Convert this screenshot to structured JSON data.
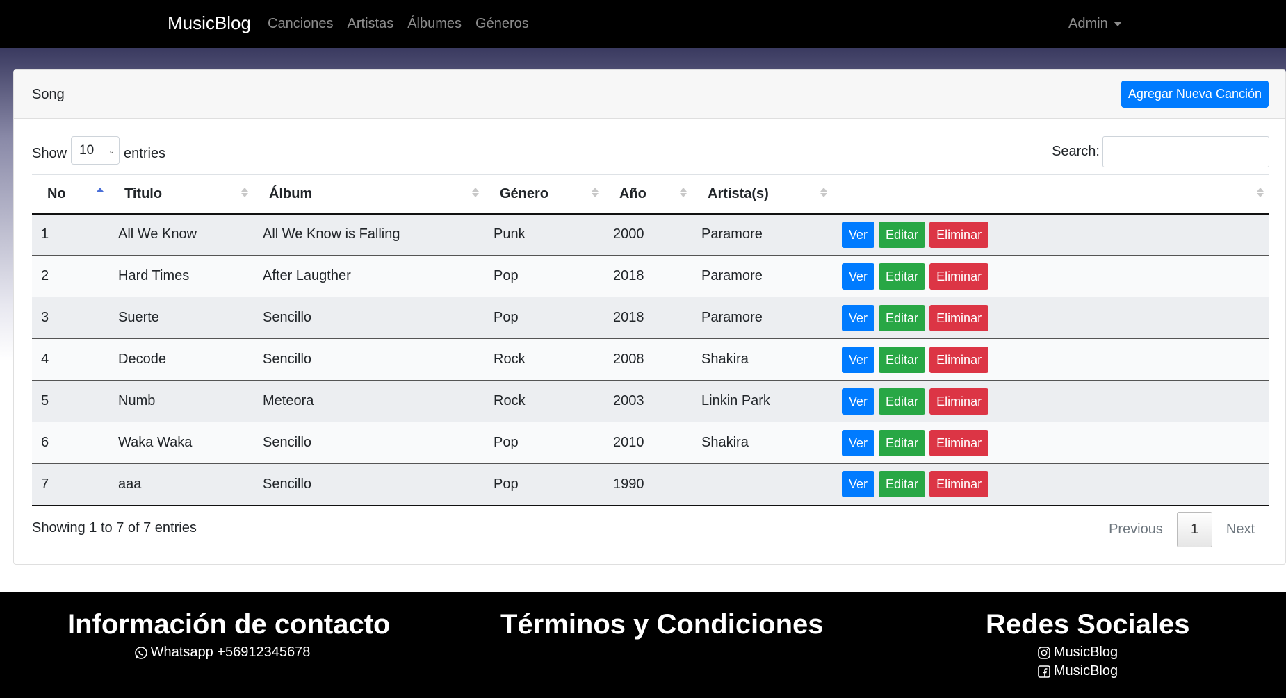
{
  "navbar": {
    "brand": "MusicBlog",
    "links": [
      "Canciones",
      "Artistas",
      "Álbumes",
      "Géneros"
    ],
    "user": "Admin"
  },
  "card": {
    "title": "Song",
    "add_button": "Agregar Nueva Canción"
  },
  "controls": {
    "show_label": "Show",
    "entries_value": "10",
    "entries_label": "entries",
    "search_label": "Search:",
    "search_value": ""
  },
  "table": {
    "headers": [
      "No",
      "Titulo",
      "Álbum",
      "Género",
      "Año",
      "Artista(s)",
      ""
    ],
    "rows": [
      [
        "1",
        "All We Know",
        "All We Know is Falling",
        "Punk",
        "2000",
        "Paramore"
      ],
      [
        "2",
        "Hard Times",
        "After Laugther",
        "Pop",
        "2018",
        "Paramore"
      ],
      [
        "3",
        "Suerte",
        "Sencillo",
        "Pop",
        "2018",
        "Paramore"
      ],
      [
        "4",
        "Decode",
        "Sencillo",
        "Rock",
        "2008",
        "Shakira"
      ],
      [
        "5",
        "Numb",
        "Meteora",
        "Rock",
        "2003",
        "Linkin Park"
      ],
      [
        "6",
        "Waka Waka",
        "Sencillo",
        "Pop",
        "2010",
        "Shakira"
      ],
      [
        "7",
        "aaa",
        "Sencillo",
        "Pop",
        "1990",
        ""
      ]
    ],
    "actions": {
      "view": "Ver",
      "edit": "Editar",
      "delete": "Eliminar"
    }
  },
  "footer_info": {
    "showing": "Showing 1 to 7 of 7 entries",
    "previous": "Previous",
    "page": "1",
    "next": "Next"
  },
  "footer": {
    "contact_title": "Información de contacto",
    "whatsapp": "Whatsapp +56912345678",
    "terms_title": "Términos y Condiciones",
    "social_title": "Redes Sociales",
    "instagram": "MusicBlog",
    "facebook": "MusicBlog"
  },
  "colors": {
    "primary": "#007bff",
    "success": "#28a745",
    "danger": "#dc3545"
  }
}
